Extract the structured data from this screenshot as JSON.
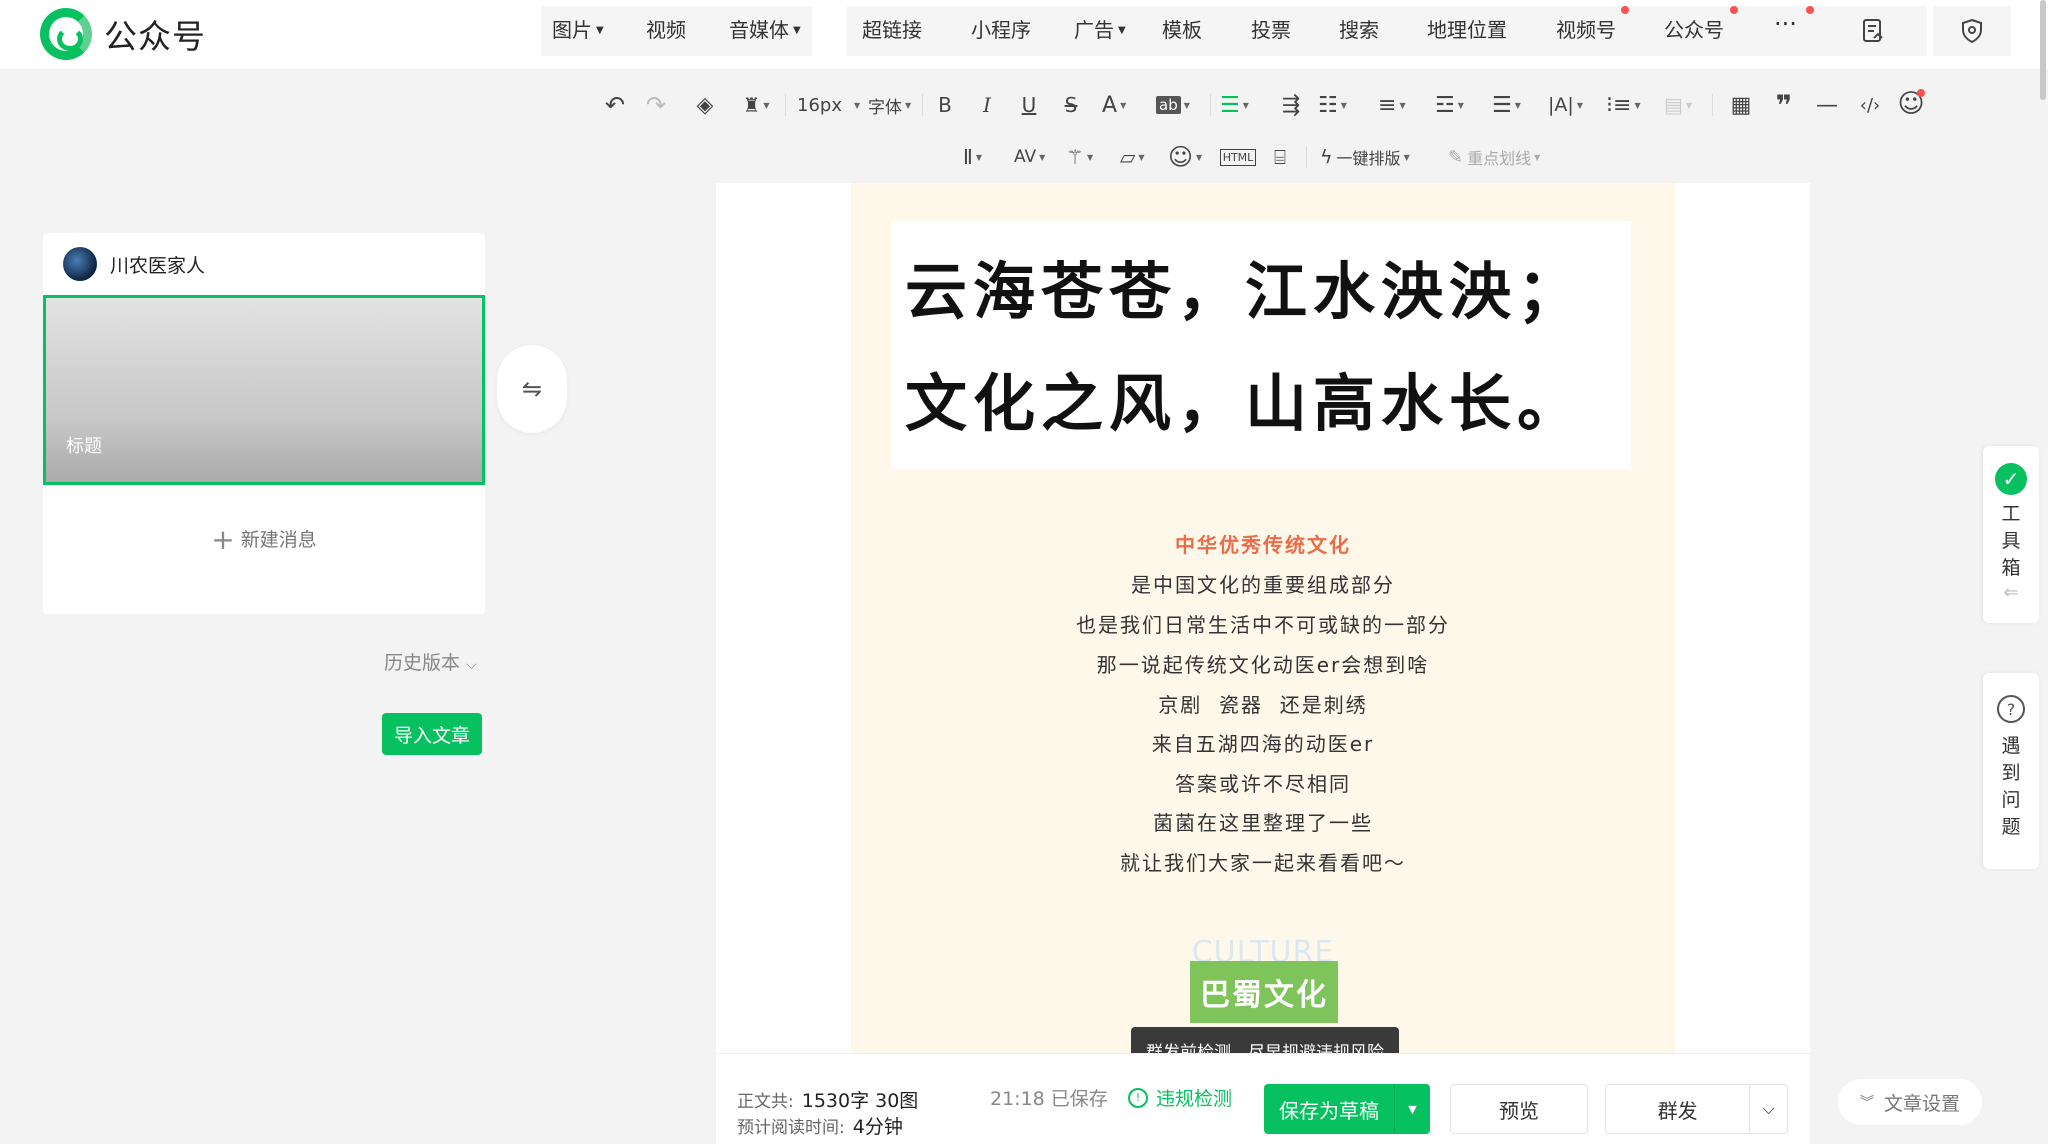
{
  "app": {
    "title": "公众号"
  },
  "nav": {
    "group1": [
      {
        "label": "图片",
        "caret": true
      },
      {
        "label": "视频",
        "caret": false
      },
      {
        "label": "音媒体",
        "caret": true
      }
    ],
    "group2": [
      {
        "label": "超链接",
        "caret": false
      },
      {
        "label": "小程序",
        "caret": false
      },
      {
        "label": "广告",
        "caret": true
      },
      {
        "label": "模板",
        "caret": false
      },
      {
        "label": "投票",
        "caret": false
      },
      {
        "label": "搜索",
        "caret": false
      },
      {
        "label": "地理位置",
        "caret": false
      },
      {
        "label": "视频号",
        "caret": false
      },
      {
        "label": "公众号",
        "caret": false
      }
    ],
    "more": "···"
  },
  "toolbar": {
    "font_size": "16px",
    "font_family": "字体",
    "bold": "B",
    "italic": "I",
    "underline": "U",
    "strike": "S",
    "font_color": "A",
    "highlight": "ab",
    "one_click_layout": "一键排版",
    "highlight_line": "重点划线"
  },
  "sidebar": {
    "account_name": "川农医家人",
    "thumb_title": "标题",
    "new_message": "新建消息",
    "history": "历史版本",
    "import": "导入文章"
  },
  "article": {
    "poem_line1": "云海苍苍，江水泱泱；",
    "poem_line2": "文化之风，山高水长。",
    "heading": "中华优秀传统文化",
    "lines": [
      "是中国文化的重要组成部分",
      "也是我们日常生活中不可或缺的一部分",
      "那一说起传统文化动医er会想到啥",
      "京剧  瓷器  还是刺绣",
      "来自五湖四海的动医er",
      "答案或许不尽相同",
      "菌菌在这里整理了一些",
      "就让我们大家一起来看看吧～"
    ],
    "culture_en": "CULTURE",
    "culture_cn": "巴蜀文化"
  },
  "tooltip": "群发前检测，尽早规避违规风险",
  "footer": {
    "word_label": "正文共:",
    "word_value": "1530字 30图",
    "read_label": "预计阅读时间:",
    "read_value": "4分钟",
    "save_time": "21:18 已保存",
    "check": "违规检测",
    "save_draft": "保存为草稿",
    "preview": "预览",
    "publish": "群发",
    "settings": "文章设置"
  },
  "right": {
    "toolbox": [
      "工",
      "具",
      "箱"
    ],
    "help": [
      "遇",
      "到",
      "问",
      "题"
    ]
  }
}
